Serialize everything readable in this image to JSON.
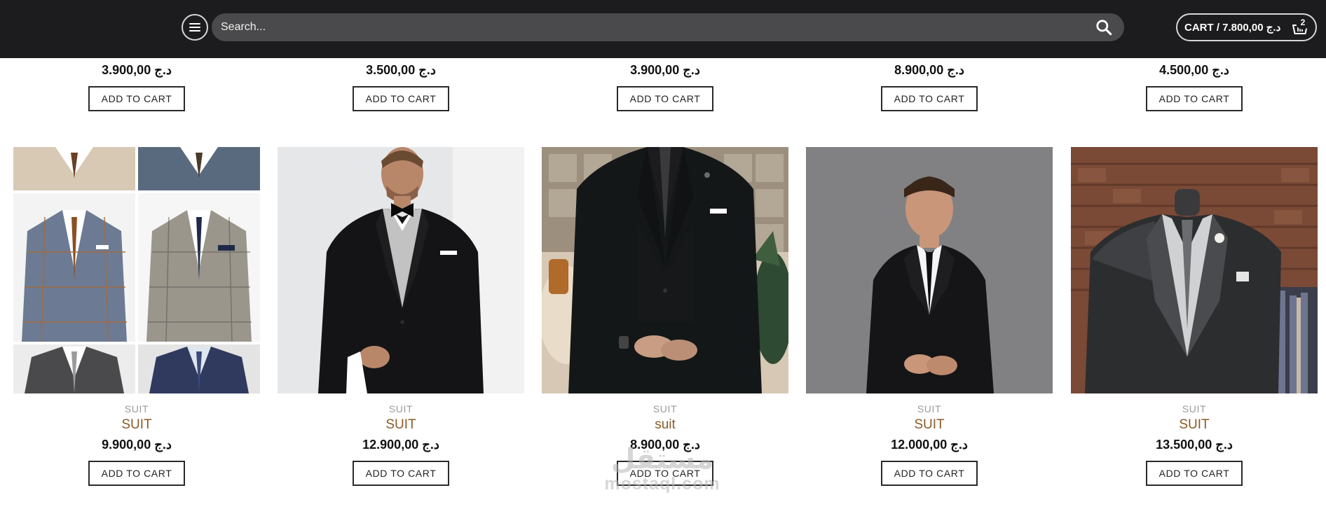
{
  "header": {
    "search_placeholder": "Search...",
    "cart_label": "CART / 7.800,00 د.ج",
    "cart_count": "2",
    "background": "#1c1c1e"
  },
  "top_row": [
    {
      "price": "3.900,00 د.ج",
      "button": "ADD TO CART"
    },
    {
      "price": "3.500,00 د.ج",
      "button": "ADD TO CART"
    },
    {
      "price": "3.900,00 د.ج",
      "button": "ADD TO CART"
    },
    {
      "price": "8.900,00 د.ج",
      "button": "ADD TO CART"
    },
    {
      "price": "4.500,00 د.ج",
      "button": "ADD TO CART"
    }
  ],
  "products": [
    {
      "image": "patterned-blazers-collage",
      "category": "SUIT",
      "title": "SUIT",
      "price": "9.900,00 د.ج",
      "button": "ADD TO CART"
    },
    {
      "image": "man-in-black-tuxedo",
      "category": "SUIT",
      "title": "SUIT",
      "price": "12.900,00 د.ج",
      "button": "ADD TO CART"
    },
    {
      "image": "black-three-piece-suit",
      "category": "SUIT",
      "title": "suit",
      "price": "8.900,00 د.ج",
      "button": "ADD TO CART"
    },
    {
      "image": "man-in-black-suit-gray-background",
      "category": "SUIT",
      "title": "SUIT",
      "price": "12.000,00 د.ج",
      "button": "ADD TO CART"
    },
    {
      "image": "suit-on-mannequin",
      "category": "SUIT",
      "title": "SUIT",
      "price": "13.500,00 د.ج",
      "button": "ADD TO CART"
    }
  ],
  "watermark": {
    "arabic": "مستقل",
    "latin": "mostaql.com"
  },
  "colors": {
    "title": "#8a5a26",
    "category": "#9a9a9a",
    "button_border": "#2a2a2a"
  }
}
